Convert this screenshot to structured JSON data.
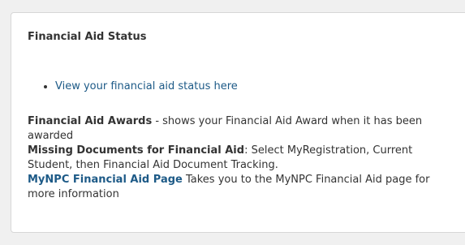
{
  "panel": {
    "title": "Financial Aid Status",
    "links": [
      {
        "label": "View your financial aid status here"
      }
    ],
    "items": [
      {
        "label": "Financial Aid Awards",
        "text": " - shows your Financial Aid Award when it has been awarded"
      },
      {
        "label": "Missing Documents for Financial Aid",
        "text": ": Select MyRegistration, Current Student, then Financial Aid Document Tracking."
      },
      {
        "label": "MyNPC Financial Aid Page",
        "text": " Takes you to the MyNPC Financial Aid page for more information"
      }
    ]
  },
  "colors": {
    "link": "#1d5a87",
    "text": "#333333",
    "background": "#f0f0f0",
    "card": "#ffffff",
    "border": "#d7d7d7"
  }
}
